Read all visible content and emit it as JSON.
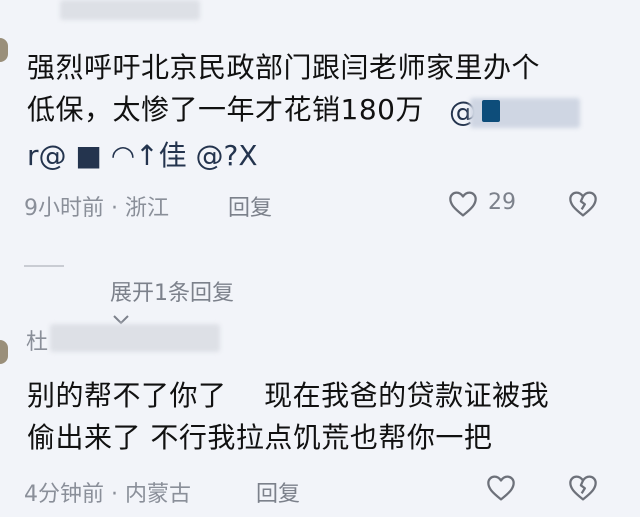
{
  "comments": [
    {
      "text_line1": "强烈呼吁北京民政部门跟闫老师家里办个",
      "text_line2": "低保，太惨了一年才花销180万",
      "text_line2_mention": "@",
      "partial_third_line": "r@ ■ ◠↑佳 @?X",
      "time_location": "9小时前 · 浙江",
      "reply_label": "回复",
      "like_count": "29",
      "expand_replies": "展开1条回复"
    },
    {
      "username_partial": "杜",
      "text_line1": "别的帮不了你了    现在我爸的贷款证被我",
      "text_line2": "偷出来了 不行我拉点饥荒也帮你一把",
      "time_location": "4分钟前 · 内蒙古",
      "reply_label": "回复"
    }
  ],
  "icons": {
    "like": "heart-outline-icon",
    "dislike": "broken-heart-icon",
    "expand": "chevron-down-icon"
  }
}
